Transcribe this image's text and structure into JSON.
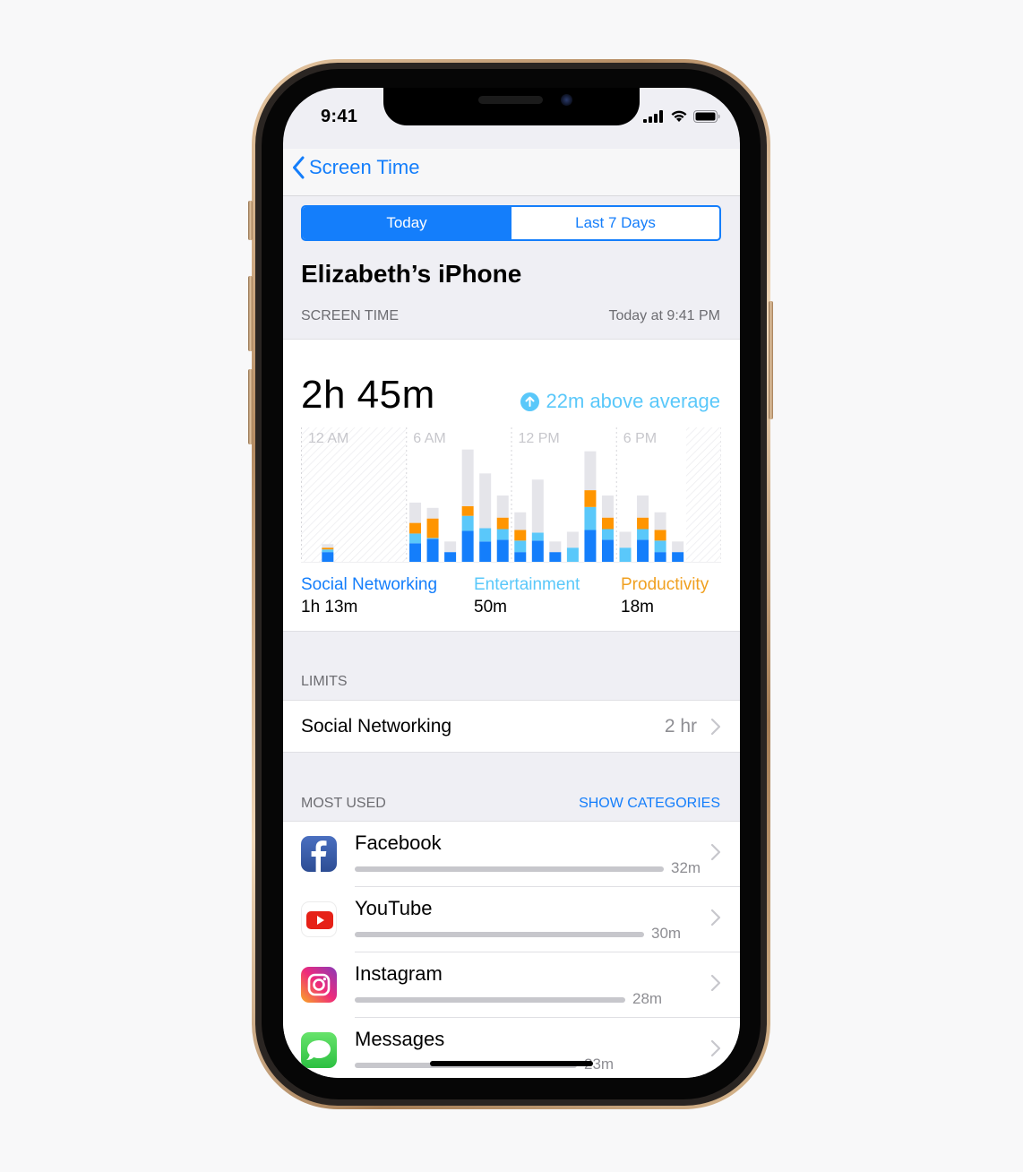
{
  "status_bar": {
    "time": "9:41",
    "icons": [
      "cellular-signal-icon",
      "wifi-icon",
      "battery-icon"
    ]
  },
  "nav": {
    "back_label": "Screen Time",
    "back_icon": "chevron-left-icon"
  },
  "segmented_control": {
    "options": [
      {
        "label": "Today",
        "selected": true
      },
      {
        "label": "Last 7 Days",
        "selected": false
      }
    ]
  },
  "device_title": "Elizabeth’s iPhone",
  "screen_time_section": {
    "header": "SCREEN TIME",
    "timestamp": "Today at 9:41 PM",
    "total": "2h 45m",
    "delta_icon": "arrow-up-circle-icon",
    "delta_text": "22m above average"
  },
  "colors": {
    "accent": "#147efb",
    "social": "#147efb",
    "entertainment": "#5ac8fa",
    "productivity": "#ff9500",
    "other": "#e5e5ea",
    "secondary_text": "#8e8e93"
  },
  "chart_data": {
    "type": "bar",
    "stacked": true,
    "title": "",
    "xlabel": "",
    "ylabel": "",
    "unit": "minutes",
    "x_tick_labels": [
      "12 AM",
      "6 AM",
      "12 PM",
      "6 PM"
    ],
    "hours": [
      0,
      1,
      2,
      3,
      4,
      5,
      6,
      7,
      8,
      9,
      10,
      11,
      12,
      13,
      14,
      15,
      16,
      17,
      18,
      19,
      20,
      21,
      22,
      23
    ],
    "ylim": [
      0,
      60
    ],
    "downtime_hours": [
      [
        0,
        6
      ],
      [
        22,
        24
      ]
    ],
    "series": [
      {
        "name": "Social Networking",
        "color": "#147efb",
        "values": [
          0,
          4.4,
          0,
          0,
          0,
          0,
          8.4,
          10.4,
          4.4,
          14,
          9.2,
          10,
          4.4,
          9.6,
          4.4,
          0,
          14.4,
          10,
          0,
          10,
          4.4,
          4.4,
          0,
          0
        ]
      },
      {
        "name": "Entertainment",
        "color": "#5ac8fa",
        "values": [
          0,
          1.2,
          0,
          0,
          0,
          0,
          4.4,
          0.4,
          0,
          6.8,
          6,
          4.8,
          5.2,
          3.6,
          0,
          6.4,
          10.4,
          4.8,
          6.4,
          4.8,
          5.2,
          0,
          0,
          0
        ]
      },
      {
        "name": "Productivity",
        "color": "#ff9500",
        "values": [
          0,
          0.8,
          0,
          0,
          0,
          0,
          4.8,
          8.8,
          0,
          4.4,
          0,
          5.2,
          4.8,
          0,
          0,
          0,
          7.6,
          5.2,
          0,
          5.2,
          4.8,
          0,
          0,
          0
        ]
      },
      {
        "name": "Other",
        "color": "#e5e5ea",
        "values": [
          0,
          1.6,
          0,
          0,
          0,
          0,
          9.2,
          4.8,
          4.8,
          25.6,
          24.8,
          10,
          8,
          24,
          4.8,
          7.2,
          17.6,
          10,
          7.2,
          10,
          8,
          4.8,
          0,
          0
        ]
      }
    ],
    "legend": [
      {
        "label": "Social Networking",
        "value": "1h 13m",
        "color": "#147efb"
      },
      {
        "label": "Entertainment",
        "value": "50m",
        "color": "#5ac8fa"
      },
      {
        "label": "Productivity",
        "value": "18m",
        "color": "#f0a020"
      }
    ]
  },
  "limits_section": {
    "header": "LIMITS",
    "items": [
      {
        "label": "Social Networking",
        "value": "2 hr"
      }
    ]
  },
  "most_used_section": {
    "header": "MOST USED",
    "action": "SHOW CATEGORIES",
    "apps": [
      {
        "name": "Facebook",
        "time": "32m",
        "minutes": 32,
        "icon": "facebook-icon"
      },
      {
        "name": "YouTube",
        "time": "30m",
        "minutes": 30,
        "icon": "youtube-icon"
      },
      {
        "name": "Instagram",
        "time": "28m",
        "minutes": 28,
        "icon": "instagram-icon"
      },
      {
        "name": "Messages",
        "time": "23m",
        "minutes": 23,
        "icon": "messages-icon"
      }
    ]
  }
}
